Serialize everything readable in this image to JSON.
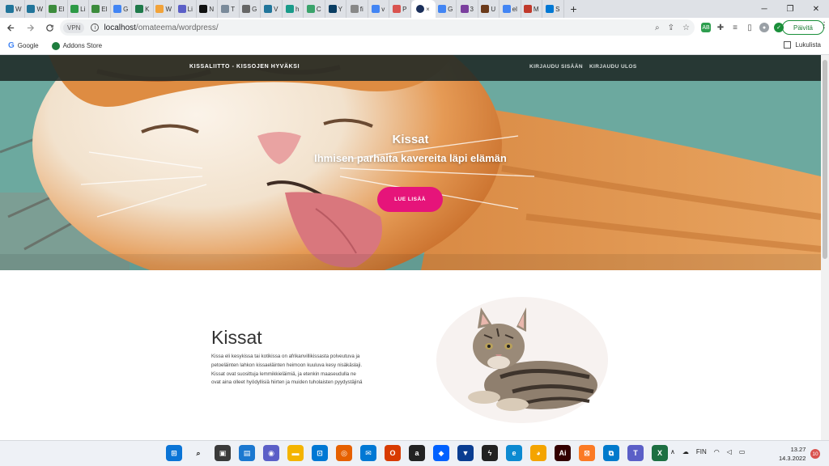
{
  "browser": {
    "tabs": [
      {
        "label": "W",
        "color": "#21759b"
      },
      {
        "label": "W",
        "color": "#21759b"
      },
      {
        "label": "El",
        "color": "#3c8c3c"
      },
      {
        "label": "Li",
        "color": "#2d9a46"
      },
      {
        "label": "El",
        "color": "#3c8c3c"
      },
      {
        "label": "G",
        "color": "#4285f4"
      },
      {
        "label": "K",
        "color": "#1f7a4a"
      },
      {
        "label": "W",
        "color": "#f2a33a"
      },
      {
        "label": "Li",
        "color": "#5b5fc7"
      },
      {
        "label": "N",
        "color": "#111111"
      },
      {
        "label": "T",
        "color": "#7a8a9a"
      },
      {
        "label": "G",
        "color": "#666666"
      },
      {
        "label": "V",
        "color": "#21759b"
      },
      {
        "label": "h",
        "color": "#1a9b8a"
      },
      {
        "label": "C",
        "color": "#3aa36b"
      },
      {
        "label": "Y",
        "color": "#0a3d62"
      },
      {
        "label": "fi",
        "color": "#888888"
      },
      {
        "label": "v",
        "color": "#4285f4"
      },
      {
        "label": "P",
        "color": "#d9534f"
      },
      {
        "label": "G",
        "color": "#4285f4"
      },
      {
        "label": "3",
        "color": "#7b3f9e"
      },
      {
        "label": "U",
        "color": "#6b3a1a"
      },
      {
        "label": "el",
        "color": "#4285f4"
      },
      {
        "label": "M",
        "color": "#c0392b"
      },
      {
        "label": "S",
        "color": "#0078d4"
      }
    ],
    "active_tab_label": "×",
    "new_tab": "+",
    "window_controls": {
      "minimize": "─",
      "restore": "❐",
      "close": "✕"
    },
    "vpn_label": "VPN",
    "url_host": "localhost",
    "url_path": "/omateema/wordpress/",
    "update_label": "Päivitä",
    "bookmarks": [
      {
        "label": "Google"
      },
      {
        "label": "Addons Store"
      }
    ],
    "reading_list": "Lukulista"
  },
  "site": {
    "title": "KISSALIITTO - KISSOJEN HYVÄKSI",
    "nav": [
      "KIRJAUDU SISÄÄN",
      "KIRJAUDU ULOS"
    ],
    "hero_title": "Kissat",
    "hero_subtitle": "Ihmisen parhaita kavereita läpi elämän",
    "hero_button": "LUE LISÄÄ",
    "content_title": "Kissat",
    "content_lines": [
      "Kissa eli kesykissa tai kotikissa on afrikanvillikissasta polveutuva ja",
      "petoeläinten lahkon kissaeläinten heimoon kuuluva kesy nisäkäslaji.",
      "Kissat ovat suosittuja lemmikkieläimiä, ja etenkin maaseudulla ne",
      "ovat aina olleet hyödyllisiä hiirten ja muiden tuholaisten pyydystäjinä"
    ]
  },
  "taskbar": {
    "apps": [
      {
        "name": "windows-start",
        "color": "#0a74d6",
        "glyph": "⊞"
      },
      {
        "name": "search",
        "color": "#eef1f6",
        "glyph": "⌕"
      },
      {
        "name": "task-view",
        "color": "#3a3a3a",
        "glyph": "▣"
      },
      {
        "name": "widgets",
        "color": "#1b78d0",
        "glyph": "▤"
      },
      {
        "name": "teams-chat",
        "color": "#5b5fc7",
        "glyph": "◉"
      },
      {
        "name": "file-explorer",
        "color": "#f4b400",
        "glyph": "▬"
      },
      {
        "name": "store",
        "color": "#0078d4",
        "glyph": "⊡"
      },
      {
        "name": "firefox",
        "color": "#e66000",
        "glyph": "◎"
      },
      {
        "name": "mail",
        "color": "#0078d4",
        "glyph": "✉"
      },
      {
        "name": "office",
        "color": "#d83b01",
        "glyph": "O"
      },
      {
        "name": "amazon",
        "color": "#222222",
        "glyph": "a"
      },
      {
        "name": "dropbox",
        "color": "#0061ff",
        "glyph": "◆"
      },
      {
        "name": "security",
        "color": "#0a3d91",
        "glyph": "▼"
      },
      {
        "name": "terminal",
        "color": "#222222",
        "glyph": "ϟ"
      },
      {
        "name": "edge",
        "color": "#0c8ad1",
        "glyph": "e"
      },
      {
        "name": "chrome",
        "color": "#f4a400",
        "glyph": "◕"
      },
      {
        "name": "illustrator",
        "color": "#330000",
        "glyph": "Ai"
      },
      {
        "name": "xampp",
        "color": "#fb7a24",
        "glyph": "⊠"
      },
      {
        "name": "vscode",
        "color": "#007acc",
        "glyph": "⧉"
      },
      {
        "name": "teams",
        "color": "#5b5fc7",
        "glyph": "T"
      },
      {
        "name": "excel",
        "color": "#1d6f42",
        "glyph": "X"
      }
    ],
    "tray_language": "FIN",
    "time": "13.27",
    "date": "14.3.2022",
    "notifications": "10"
  }
}
